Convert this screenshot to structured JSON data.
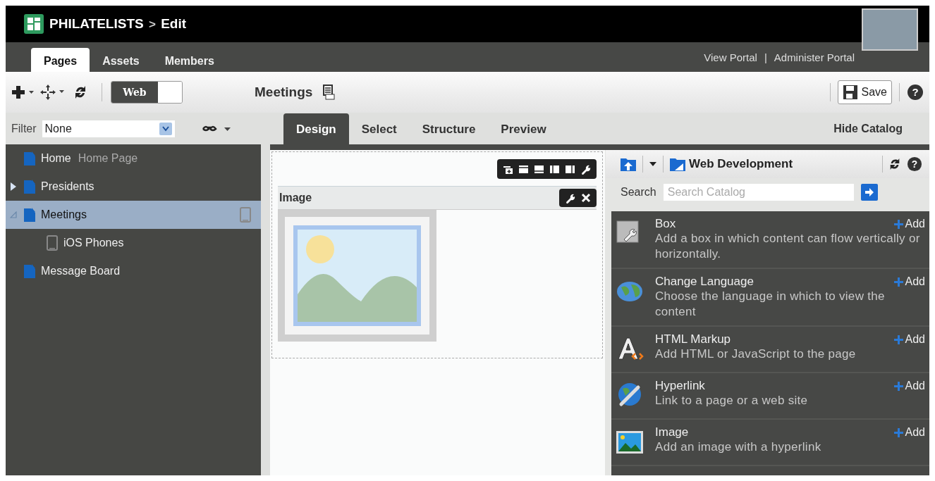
{
  "header": {
    "site": "PHILATELISTS",
    "separator": ">",
    "mode": "Edit"
  },
  "main_tabs": [
    {
      "label": "Pages",
      "selected": true
    },
    {
      "label": "Assets",
      "selected": false
    },
    {
      "label": "Members",
      "selected": false
    }
  ],
  "portal_links": {
    "view": "View Portal",
    "divider": "|",
    "admin": "Administer Portal"
  },
  "toolbar": {
    "web_toggle": {
      "label": "Web",
      "on": true
    },
    "page_title": "Meetings",
    "save": "Save",
    "help": "?"
  },
  "filter": {
    "label": "Filter",
    "value": "None"
  },
  "view_tabs": [
    {
      "label": "Design",
      "selected": true
    },
    {
      "label": "Select",
      "selected": false
    },
    {
      "label": "Structure",
      "selected": false
    },
    {
      "label": "Preview",
      "selected": false
    }
  ],
  "hide_catalog": "Hide Catalog",
  "tree": [
    {
      "label": "Home",
      "note": "Home Page",
      "kind": "page",
      "selected": false
    },
    {
      "label": "Presidents",
      "kind": "page",
      "expanded": false,
      "selected": false
    },
    {
      "label": "Meetings",
      "kind": "page",
      "expanded": true,
      "selected": true,
      "device_badge": true,
      "children": [
        {
          "label": "iOS Phones",
          "kind": "device",
          "selected": false
        }
      ]
    },
    {
      "label": "Message Board",
      "kind": "page",
      "selected": false
    }
  ],
  "canvas": {
    "region_title": "Image"
  },
  "catalog": {
    "folder": "Web Development",
    "search_label": "Search",
    "search_placeholder": "Search Catalog",
    "help": "?",
    "items": [
      {
        "name": "Box",
        "description": "Add a box in which content can flow vertically or horizontally.",
        "action": "Add"
      },
      {
        "name": "Change Language",
        "description": "Choose the language in which to view the content",
        "action": "Add"
      },
      {
        "name": "HTML Markup",
        "description": "Add HTML or JavaScript to the page",
        "action": "Add"
      },
      {
        "name": "Hyperlink",
        "description": "Link to a page or a web site",
        "action": "Add"
      },
      {
        "name": "Image",
        "description": "Add an image with a hyperlink",
        "action": "Add"
      }
    ]
  }
}
